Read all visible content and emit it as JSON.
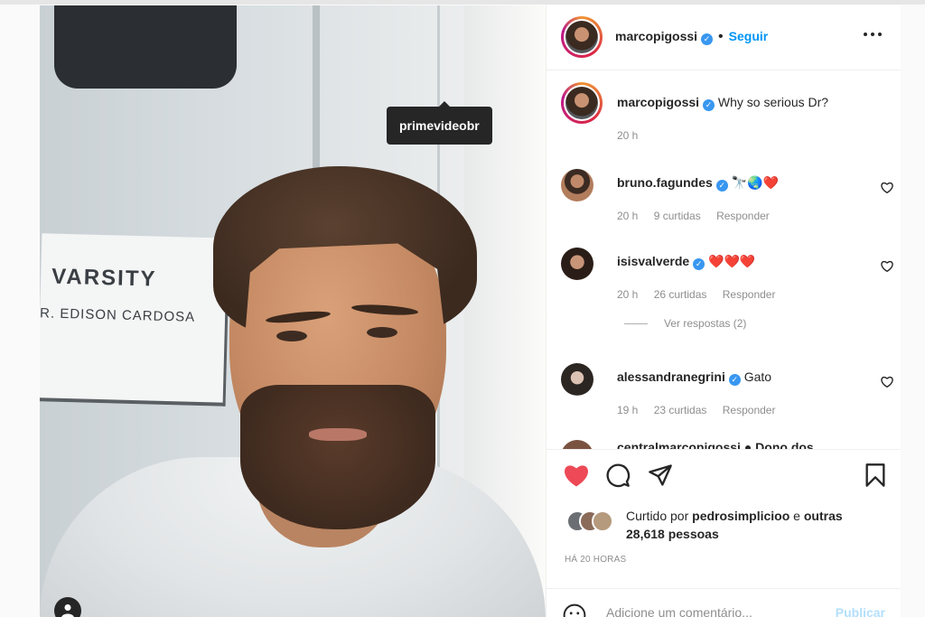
{
  "photo": {
    "sign_title": "VARSITY",
    "sign_subtitle": "R. EDISON CARDOSA",
    "tag_tooltip": "primevideobr"
  },
  "header": {
    "username": "marcopigossi",
    "follow_label": "Seguir",
    "dot": "•"
  },
  "caption": {
    "username": "marcopigossi",
    "text": "Why so serious Dr?",
    "time": "20 h"
  },
  "comments": [
    {
      "username": "bruno.fagundes",
      "text": "🔭🌏❤️",
      "time": "20 h",
      "likes": "9 curtidas",
      "reply": "Responder"
    },
    {
      "username": "isisvalverde",
      "text": "❤️❤️❤️",
      "time": "20 h",
      "likes": "26 curtidas",
      "reply": "Responder"
    },
    {
      "username": "alessandranegrini",
      "text": "Gato",
      "time": "19 h",
      "likes": "23 curtidas",
      "reply": "Responder"
    }
  ],
  "view_replies": "Ver respostas (2)",
  "partial_comment": "centralmarcopigossi ● Dono dos",
  "likes": {
    "prefix": "Curtido por",
    "user": "pedrosimplicioo",
    "connector": "e",
    "others": "outras 28,618 pessoas"
  },
  "post_time": "HÁ 20 HORAS",
  "add_comment": {
    "placeholder": "Adicione um comentário...",
    "publish": "Publicar"
  },
  "colors": {
    "like_red": "#ed4956",
    "link_blue": "#0095f6",
    "verified": "#3897f0"
  }
}
